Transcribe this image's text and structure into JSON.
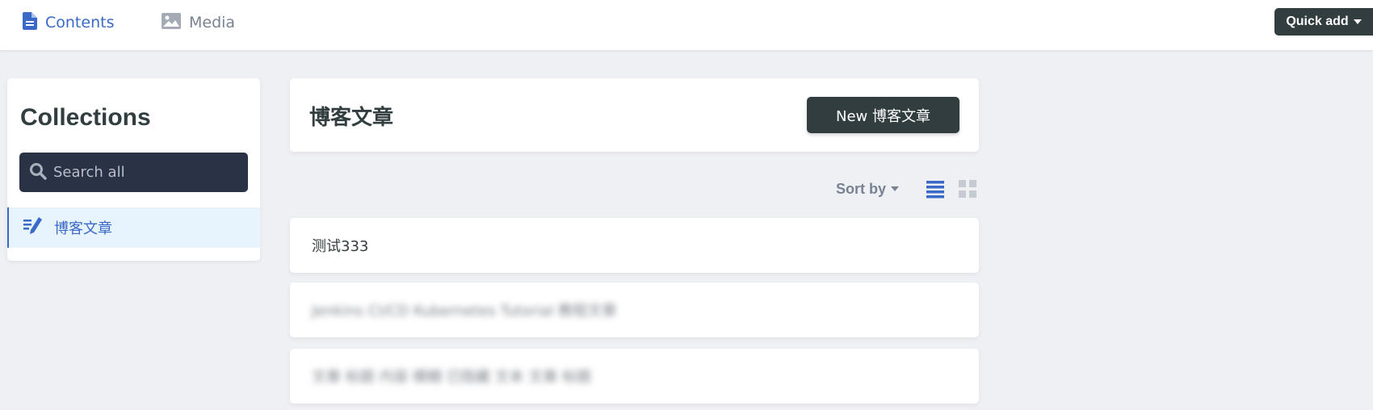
{
  "topbar": {
    "nav": [
      {
        "label": "Contents",
        "icon": "document-icon",
        "active": true
      },
      {
        "label": "Media",
        "icon": "image-icon",
        "active": false
      }
    ],
    "quick_add_label": "Quick add"
  },
  "sidebar": {
    "title": "Collections",
    "search_placeholder": "Search all",
    "items": [
      {
        "label": "博客文章",
        "icon": "edit-list-icon",
        "active": true
      }
    ]
  },
  "main": {
    "collection_title": "博客文章",
    "new_button_label": "New 博客文章",
    "sort_by_label": "Sort by",
    "entries": [
      {
        "title": "测试333"
      },
      {
        "title": "Jenkins CI/CD Kubernetes Tutorial 教程文章"
      },
      {
        "title": "文章 标题 内容 模糊 已隐藏 文本 文章 标题"
      }
    ]
  },
  "colors": {
    "accent": "#3a69c7",
    "dark": "#313d3e",
    "background": "#eff0f4",
    "search_bg": "#2a3246",
    "active_item_bg": "#e8f4fd"
  }
}
